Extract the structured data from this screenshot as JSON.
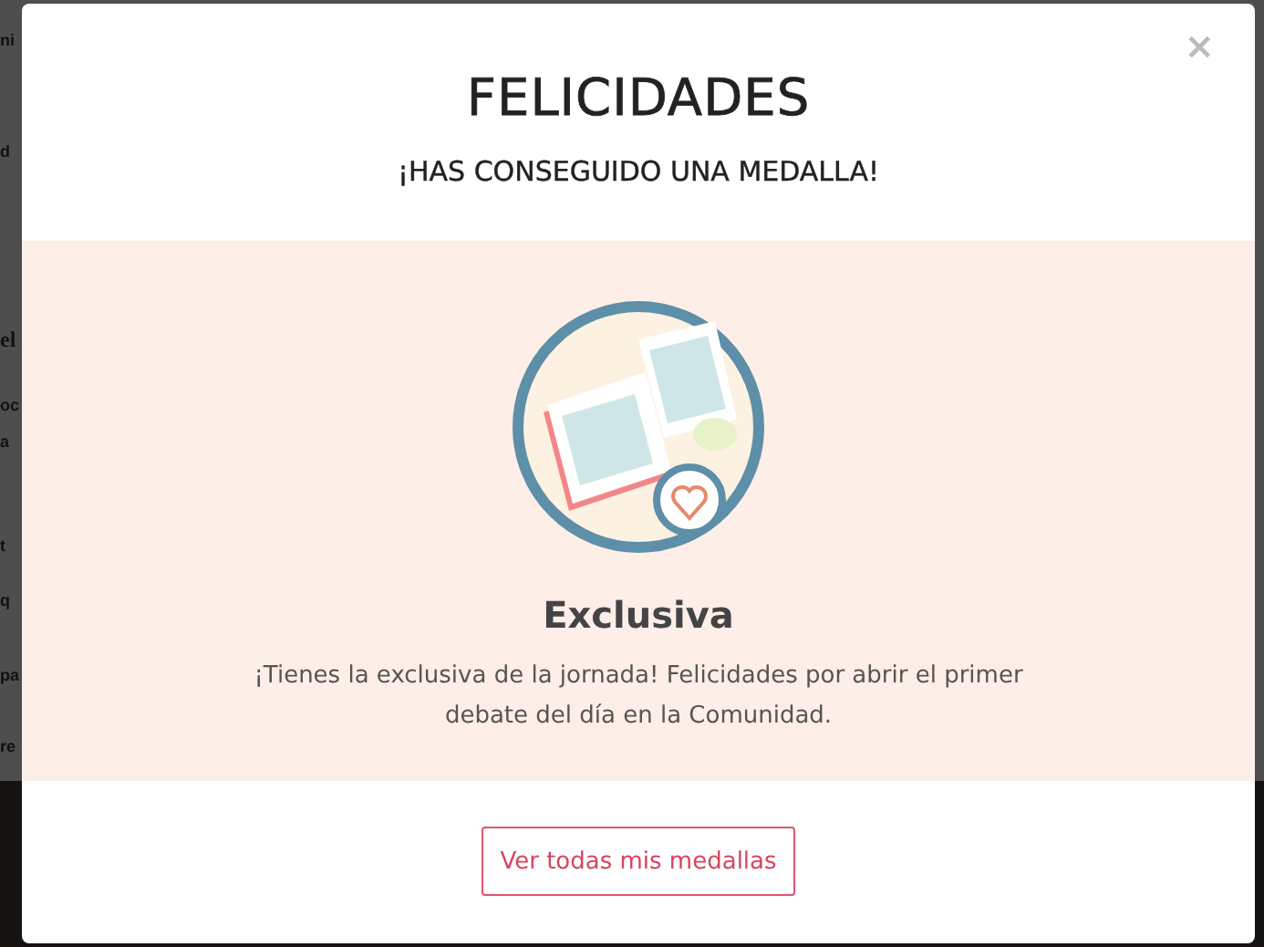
{
  "background": {
    "fragments": [
      {
        "text": "ni",
        "kind": "line"
      },
      {
        "text": "d",
        "kind": "line"
      },
      {
        "text": "el",
        "kind": "heading"
      },
      {
        "text": "oc",
        "kind": "line"
      },
      {
        "text": "a",
        "kind": "line"
      },
      {
        "text": "t",
        "kind": "line"
      },
      {
        "text": "q",
        "kind": "line"
      },
      {
        "text": "pa",
        "kind": "line"
      },
      {
        "text": "re",
        "kind": "line"
      }
    ]
  },
  "modal": {
    "close": "×",
    "title": "FELICIDADES",
    "subtitle": "¡HAS CONSEGUIDO UNA MEDALLA!",
    "medal": {
      "name": "Exclusiva",
      "description": "¡Tienes la exclusiva de la jornada! Felicidades por abrir el primer debate del día en la Comunidad."
    },
    "button": "Ver todas mis medallas"
  }
}
